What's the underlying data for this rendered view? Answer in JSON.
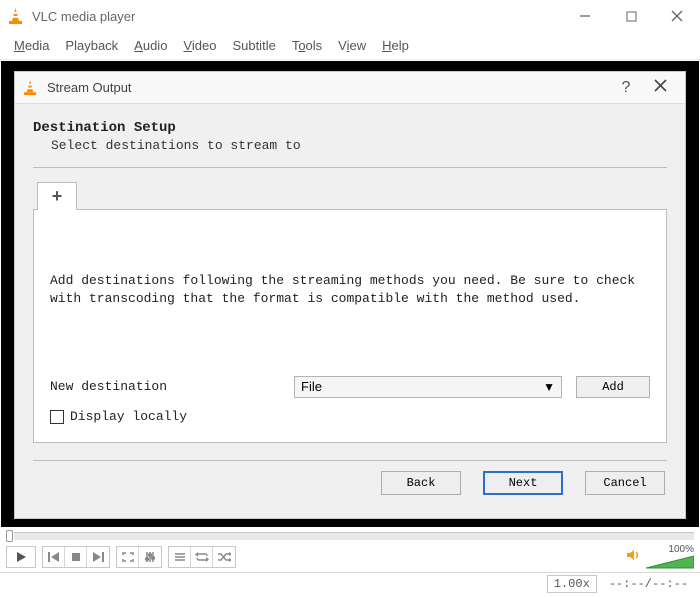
{
  "app": {
    "title": "VLC media player"
  },
  "menu": {
    "media": "Media",
    "playback": "Playback",
    "audio": "Audio",
    "video": "Video",
    "subtitle": "Subtitle",
    "tools": "Tools",
    "view": "View",
    "help": "Help"
  },
  "dialog": {
    "title": "Stream Output",
    "help_char": "?",
    "section_title": "Destination Setup",
    "section_sub": "Select destinations to stream to",
    "tab_add_char": "+",
    "info_text": "Add destinations following the streaming methods you need. Be sure to check with transcoding that the format is compatible with the method used.",
    "new_dest_label": "New destination",
    "dest_selected": "File",
    "add_btn": "Add",
    "display_locally_label": "Display locally",
    "display_locally_checked": false,
    "back_btn": "Back",
    "next_btn": "Next",
    "cancel_btn": "Cancel"
  },
  "controls": {
    "volume_percent": "100%",
    "speed": "1.00x",
    "time": "--:--/--:--"
  }
}
